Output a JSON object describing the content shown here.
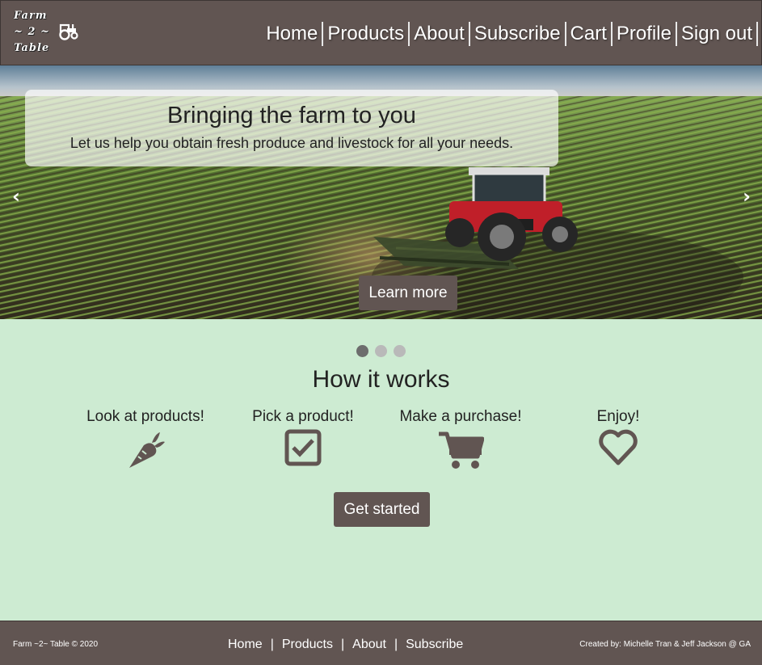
{
  "header": {
    "logo_lines": [
      "Farm",
      "~ 2 ~",
      "Table"
    ],
    "nav": [
      "Home",
      "Products",
      "About",
      "Subscribe",
      "Cart",
      "Profile",
      "Sign out"
    ]
  },
  "hero": {
    "title": "Bringing the farm to you",
    "subtitle": "Let us help you obtain fresh produce and livestock for all your needs.",
    "prev_arrow": "‹",
    "next_arrow": "›",
    "cta": "Learn more",
    "slides_count": 3,
    "active_slide": 1
  },
  "how": {
    "title": "How it works",
    "steps": [
      {
        "label": "Look at products!",
        "icon": "carrot-icon"
      },
      {
        "label": "Pick a product!",
        "icon": "checkbox-icon"
      },
      {
        "label": "Make a purchase!",
        "icon": "cart-icon"
      },
      {
        "label": "Enjoy!",
        "icon": "heart-icon"
      }
    ],
    "cta": "Get started"
  },
  "footer": {
    "copyright": "Farm ~2~ Table © 2020",
    "nav": [
      "Home",
      "Products",
      "About",
      "Subscribe"
    ],
    "separator": "|",
    "credit": "Created by: Michelle Tran & Jeff Jackson @ GA"
  },
  "colors": {
    "header_bg": "#615552",
    "page_bg": "#cdebd2",
    "button_bg": "#615552",
    "icon_color": "#615552"
  }
}
